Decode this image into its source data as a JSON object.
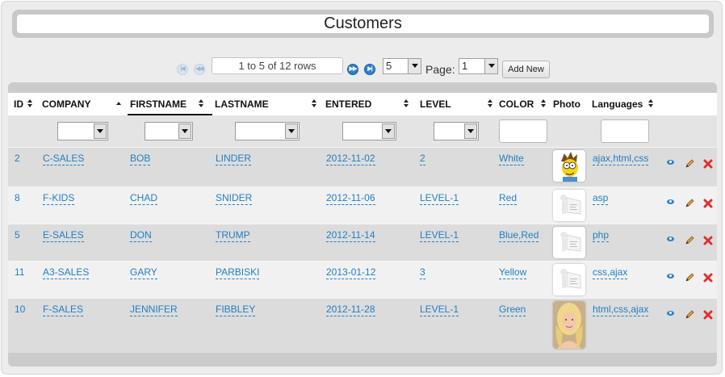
{
  "title": "Customers",
  "pager": {
    "first_icon": "first-page-icon",
    "prev_icon": "prev-page-icon",
    "next_icon": "next-page-icon",
    "last_icon": "last-page-icon",
    "rows_text": "1 to 5 of 12 rows",
    "page_size": "5",
    "page_label": "Page:",
    "page_number": "1",
    "add_label": "Add New"
  },
  "columns": {
    "id": "ID",
    "company": "COMPANY",
    "firstname": "FIRSTNAME",
    "lastname": "LASTNAME",
    "entered": "ENTERED",
    "level": "LEVEL",
    "color": "COLOR",
    "photo": "Photo",
    "languages": "Languages"
  },
  "rows": [
    {
      "id": "2",
      "company": "C-SALES",
      "firstname": "BOB",
      "lastname": "LINDER",
      "entered": "2012-11-02",
      "level": "2",
      "color": "White",
      "photo": "cartoon-avatar",
      "languages": "ajax,html,css"
    },
    {
      "id": "8",
      "company": "F-KIDS",
      "firstname": "CHAD",
      "lastname": "SNIDER",
      "entered": "2012-11-06",
      "level": "LEVEL-1",
      "color": "Red",
      "photo": "placeholder-avatar",
      "languages": "asp"
    },
    {
      "id": "5",
      "company": "E-SALES",
      "firstname": "DON",
      "lastname": "TRUMP",
      "entered": "2012-11-14",
      "level": "LEVEL-1",
      "color": "Blue,Red",
      "photo": "placeholder-avatar",
      "languages": "php"
    },
    {
      "id": "11",
      "company": "A3-SALES",
      "firstname": "GARY",
      "lastname": "PARBISKI",
      "entered": "2013-01-12",
      "level": "3",
      "color": "Yellow",
      "photo": "placeholder-avatar",
      "languages": "css,ajax"
    },
    {
      "id": "10",
      "company": "F-SALES",
      "firstname": "JENNIFER",
      "lastname": "FIBBLEY",
      "entered": "2012-11-28",
      "level": "LEVEL-1",
      "color": "Green",
      "photo": "portrait-photo",
      "languages": "html,css,ajax"
    }
  ],
  "row_actions": [
    "view-icon",
    "edit-pencil-icon",
    "delete-x-icon"
  ],
  "colors": {
    "link": "#1f7fc4",
    "delete": "#e03030",
    "pager_active": "#2f7fd0"
  }
}
